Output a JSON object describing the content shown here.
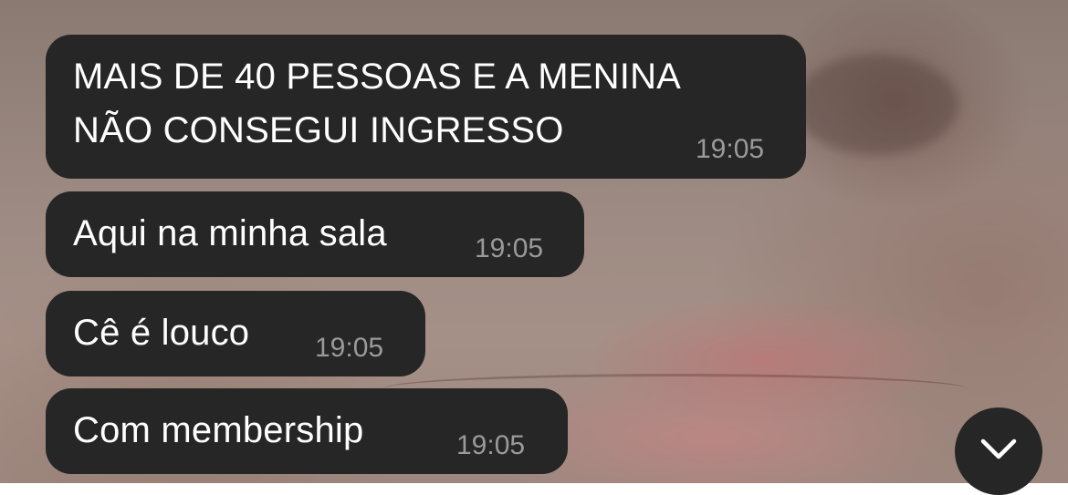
{
  "messages": [
    {
      "text_lines": [
        "MAIS DE 40 PESSOAS E A MENINA",
        "NÃO CONSEGUI INGRESSO"
      ],
      "time": "19:05"
    },
    {
      "text": "Aqui na minha sala",
      "time": "19:05"
    },
    {
      "text": "Cê é louco",
      "time": "19:05"
    },
    {
      "text": "Com membership",
      "time": "19:05"
    }
  ],
  "scroll_button": {
    "icon": "chevron-down-icon"
  },
  "colors": {
    "bubble_background": "#262626",
    "message_text": "#ffffff",
    "timestamp_text": "#9a9a9a"
  }
}
